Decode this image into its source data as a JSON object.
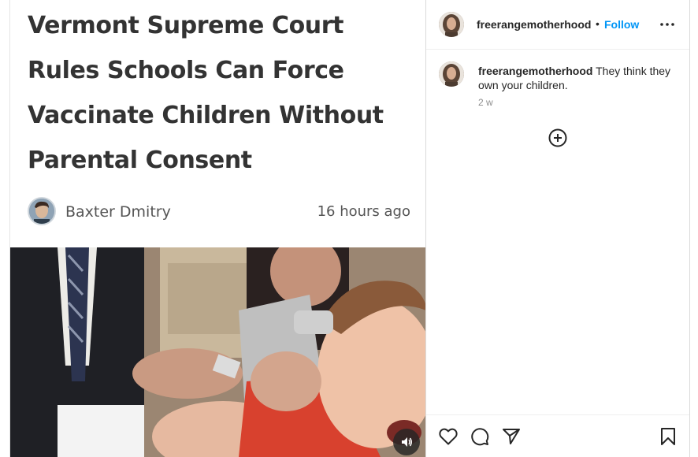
{
  "article": {
    "title": "Vermont Supreme Court Rules Schools Can Force Vaccinate Children Without Parental Consent",
    "author": "Baxter Dmitry",
    "time": "16 hours ago"
  },
  "icons": {
    "audio": "speaker-icon",
    "more": "more-options-icon",
    "load_more": "plus-circle-icon",
    "like": "heart-icon",
    "comment": "comment-bubble-icon",
    "share": "paper-plane-icon",
    "save": "bookmark-icon"
  },
  "post": {
    "username": "freerangemotherhood",
    "separator": "•",
    "follow_label": "Follow",
    "caption": {
      "username": "freerangemotherhood",
      "text": "They think they own your children.",
      "time": "2 w"
    }
  },
  "colors": {
    "follow_blue": "#0095f6",
    "title_text": "#333333",
    "meta_gray": "#8e8e8e"
  }
}
